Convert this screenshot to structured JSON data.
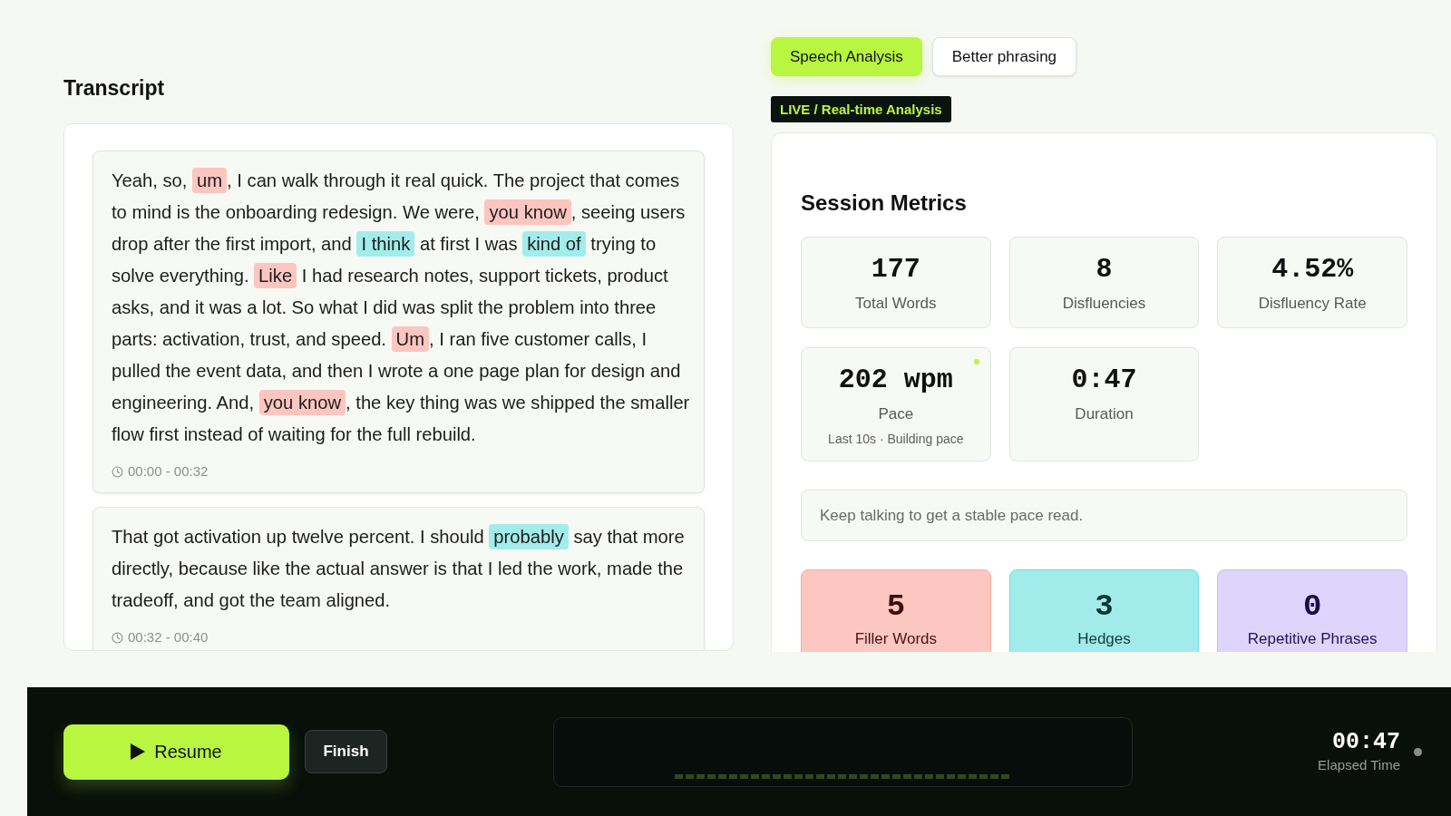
{
  "tabs": [
    {
      "label": "Speech Analysis",
      "selected": true
    },
    {
      "label": "Better phrasing",
      "selected": false
    }
  ],
  "transcript": {
    "title": "Transcript",
    "segments": [
      {
        "parts": [
          {
            "text": "Yeah, so, ",
            "kind": "plain"
          },
          {
            "text": "um",
            "kind": "filler"
          },
          {
            "text": ", I can walk through it real quick. The project that comes to mind is the onboarding redesign. We were, ",
            "kind": "plain"
          },
          {
            "text": "you know",
            "kind": "filler"
          },
          {
            "text": ", seeing users drop after the first import, and ",
            "kind": "plain"
          },
          {
            "text": "I think",
            "kind": "hedge"
          },
          {
            "text": " at first I was ",
            "kind": "plain"
          },
          {
            "text": "kind of",
            "kind": "hedge"
          },
          {
            "text": " trying to solve everything. ",
            "kind": "plain"
          },
          {
            "text": "Like",
            "kind": "filler"
          },
          {
            "text": " I had research notes, support tickets, product asks, and it was a lot. So what I did was split the problem into three parts: activation, trust, and speed. ",
            "kind": "plain"
          },
          {
            "text": "Um",
            "kind": "filler"
          },
          {
            "text": ", I ran five customer calls, I pulled the event data, and then I wrote a one page plan for design and engineering. And, ",
            "kind": "plain"
          },
          {
            "text": "you know",
            "kind": "filler"
          },
          {
            "text": ", the key thing was we shipped the smaller flow first instead of waiting for the full rebuild.",
            "kind": "plain"
          }
        ],
        "time": "00:00 - 00:32"
      },
      {
        "parts": [
          {
            "text": "That got activation up twelve percent. I should ",
            "kind": "plain"
          },
          {
            "text": "probably",
            "kind": "hedge"
          },
          {
            "text": " say that more directly, because like the actual answer is that I led the work, made the tradeoff, and got the team aligned.",
            "kind": "plain"
          }
        ],
        "time": "00:32 - 00:40"
      }
    ]
  },
  "analysis": {
    "badge": "LIVE / Real-time Analysis",
    "title": "Session Metrics",
    "metrics": [
      {
        "value": "177",
        "label": "Total Words",
        "live": false
      },
      {
        "value": "8",
        "label": "Disfluencies",
        "live": false
      },
      {
        "value": "4.52%",
        "label": "Disfluency Rate",
        "live": false
      },
      {
        "value": "202 wpm",
        "label": "Pace",
        "note": "Last 10s · Building pace",
        "live": true
      },
      {
        "value": "0:47",
        "label": "Duration",
        "live": false
      }
    ],
    "hint": "Keep talking to get a stable pace read.",
    "categories": [
      {
        "value": "5",
        "label": "Filler Words",
        "kind": "filler"
      },
      {
        "value": "3",
        "label": "Hedges",
        "kind": "hedge"
      },
      {
        "value": "0",
        "label": "Repetitive Phrases",
        "kind": "repetition"
      }
    ]
  },
  "controls": {
    "resume": "Resume",
    "finish": "Finish",
    "elapsed": "00:47",
    "elapsed_label": "Elapsed Time",
    "recording": false
  }
}
